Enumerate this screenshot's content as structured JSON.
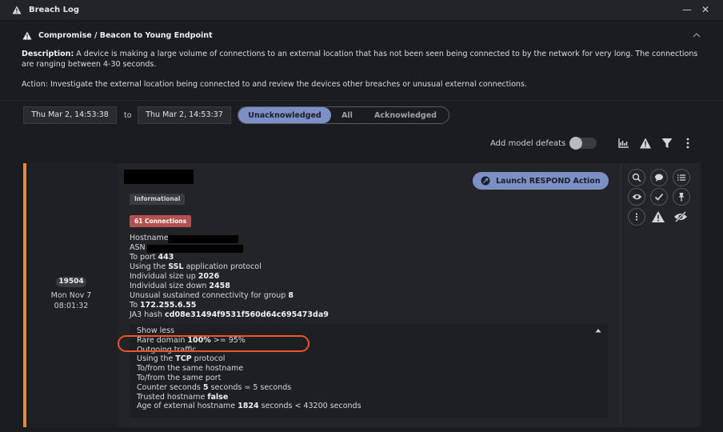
{
  "window": {
    "title": "Breach Log"
  },
  "model": {
    "name": "Compromise / Beacon to Young Endpoint",
    "description_label": "Description:",
    "description_text": " A device is making a large volume of connections to an external location that has not been seen being connected to by the network for very long. The connections are ranging between 4-30 seconds.",
    "action_text": "Action: Investigate the external location being connected to and review the devices other breaches or unusual external connections."
  },
  "filters": {
    "date_from": "Thu Mar 2, 14:53:38",
    "to_label": "to",
    "date_to": "Thu Mar 2, 14:53:37",
    "segments": [
      "Unacknowledged",
      "All",
      "Acknowledged"
    ],
    "active_segment": "Unacknowledged",
    "add_model_defeats_label": "Add model defeats",
    "add_model_defeats_enabled": false
  },
  "breach": {
    "id": "19504",
    "date_line1": "Mon Nov 7",
    "date_line2": "08:01:32",
    "severity_badge": "Informational",
    "connections_badge": "61 Connections",
    "respond_button": "Launch RESPOND Action",
    "details": {
      "hostname_label": "Hostname",
      "asn_label": "ASN",
      "port_prefix": "To port ",
      "port_value": "443",
      "ssl_prefix": "Using the ",
      "ssl_value": "SSL",
      "ssl_suffix": " application protocol",
      "size_up_prefix": "Individual size up ",
      "size_up_value": "2026",
      "size_down_prefix": "Individual size down ",
      "size_down_value": "2458",
      "unusual_prefix": "Unusual sustained connectivity for group ",
      "unusual_value": "8",
      "to_prefix": "To ",
      "to_ip": "172.255.6.55",
      "ja3_prefix": "JA3 hash ",
      "ja3_value": "cd08e31494f9531f560d64c695473da9"
    },
    "more": {
      "toggle_label": "Show less",
      "rare_prefix": "Rare domain ",
      "rare_value": "100%",
      "rare_suffix": " >= 95%",
      "outgoing": "Outgoing traffic",
      "tcp_prefix": "Using the ",
      "tcp_value": "TCP",
      "tcp_suffix": " protocol",
      "same_hostname": "To/from the same hostname",
      "same_port": "To/from the same port",
      "counter_prefix": "Counter seconds ",
      "counter_value": "5",
      "counter_suffix": " seconds = 5 seconds",
      "trusted_prefix": "Trusted hostname ",
      "trusted_value": "false",
      "age_prefix": "Age of external hostname ",
      "age_value": "1824",
      "age_suffix": " seconds < 43200 seconds"
    }
  },
  "colors": {
    "accent": "#7d90c6",
    "card_stripe": "#e58a3c",
    "connections_badge": "#b25150",
    "highlight_ring": "#f0512a"
  }
}
